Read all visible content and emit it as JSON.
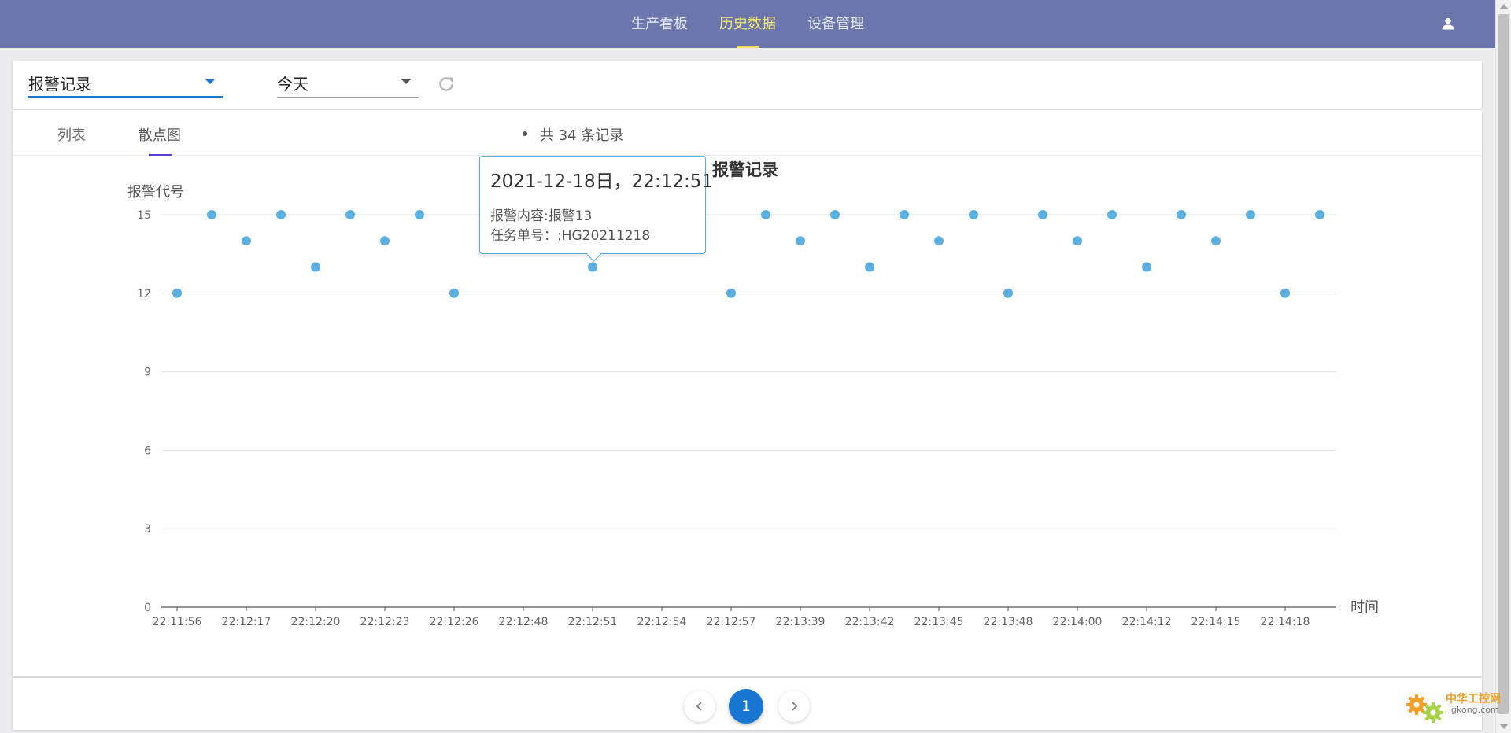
{
  "nav": {
    "items": [
      {
        "label": "生产看板",
        "active": false
      },
      {
        "label": "历史数据",
        "active": true
      },
      {
        "label": "设备管理",
        "active": false
      }
    ],
    "user_icon": "person-icon"
  },
  "filters": {
    "record_type": "报警记录",
    "date_range": "今天",
    "refresh_icon": "refresh-icon"
  },
  "tabs": {
    "list": "列表",
    "scatter": "散点图",
    "active": "scatter"
  },
  "summary": {
    "record_count_text": "共 34 条记录"
  },
  "tooltip": {
    "title": "2021-12-18日，22:12:51",
    "line1": "报警内容:报警13",
    "line2": "任务单号：:HG20211218"
  },
  "pagination": {
    "current_page": "1",
    "prev_icon": "chevron-left-icon",
    "next_icon": "chevron-right-icon"
  },
  "watermark": {
    "text1": "中华工控网",
    "text2": "gkong.com"
  },
  "colors": {
    "header": "#6b76ad",
    "active_nav": "#f5e96a",
    "accent": "#1976d2",
    "point": "#5aaee0"
  },
  "chart_data": {
    "type": "scatter",
    "title": "报警记录",
    "xlabel": "时间",
    "ylabel": "报警代号",
    "ylim": [
      0,
      15
    ],
    "yticks": [
      0,
      3,
      6,
      9,
      12,
      15
    ],
    "grid": true,
    "categories": [
      "22:11:56",
      "22:12:17",
      "22:12:20",
      "22:12:23",
      "22:12:26",
      "22:12:48",
      "22:12:51",
      "22:12:54",
      "22:12:57",
      "22:13:39",
      "22:13:42",
      "22:13:45",
      "22:13:48",
      "22:14:00",
      "22:14:12",
      "22:14:15",
      "22:14:18"
    ],
    "points": [
      {
        "x": 0,
        "y": 12
      },
      {
        "x": 0.5,
        "y": 15
      },
      {
        "x": 1,
        "y": 14
      },
      {
        "x": 1.5,
        "y": 15
      },
      {
        "x": 2,
        "y": 13
      },
      {
        "x": 2.5,
        "y": 15
      },
      {
        "x": 3,
        "y": 14
      },
      {
        "x": 3.5,
        "y": 15
      },
      {
        "x": 4,
        "y": 12
      },
      {
        "x": 6,
        "y": 13
      },
      {
        "x": 8,
        "y": 12
      },
      {
        "x": 8.5,
        "y": 15
      },
      {
        "x": 9,
        "y": 14
      },
      {
        "x": 9.5,
        "y": 15
      },
      {
        "x": 10,
        "y": 13
      },
      {
        "x": 10.5,
        "y": 15
      },
      {
        "x": 11,
        "y": 14
      },
      {
        "x": 11.5,
        "y": 15
      },
      {
        "x": 12,
        "y": 12
      },
      {
        "x": 12.5,
        "y": 15
      },
      {
        "x": 13,
        "y": 14
      },
      {
        "x": 13.5,
        "y": 15
      },
      {
        "x": 14,
        "y": 13
      },
      {
        "x": 14.5,
        "y": 15
      },
      {
        "x": 15,
        "y": 14
      },
      {
        "x": 15.5,
        "y": 15
      },
      {
        "x": 16,
        "y": 12
      },
      {
        "x": 16.5,
        "y": 15
      }
    ]
  }
}
